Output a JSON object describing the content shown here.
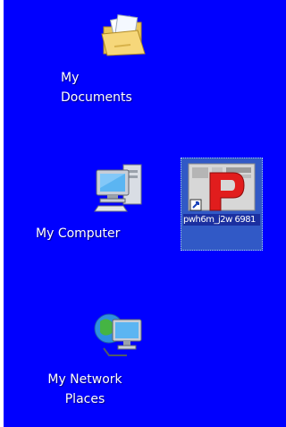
{
  "desktop": {
    "background_color": "#0000ff",
    "icons": [
      {
        "label": "My Documents",
        "icon": "folder-documents-icon"
      },
      {
        "label": "My Computer",
        "icon": "computer-icon"
      },
      {
        "label": "My Network Places",
        "icon": "network-places-icon"
      }
    ],
    "selected_shortcut": {
      "label": "pwh6m_j2w 6981",
      "icon": "powerpoint-shortcut-icon",
      "selection_color": "#3159c6"
    }
  }
}
